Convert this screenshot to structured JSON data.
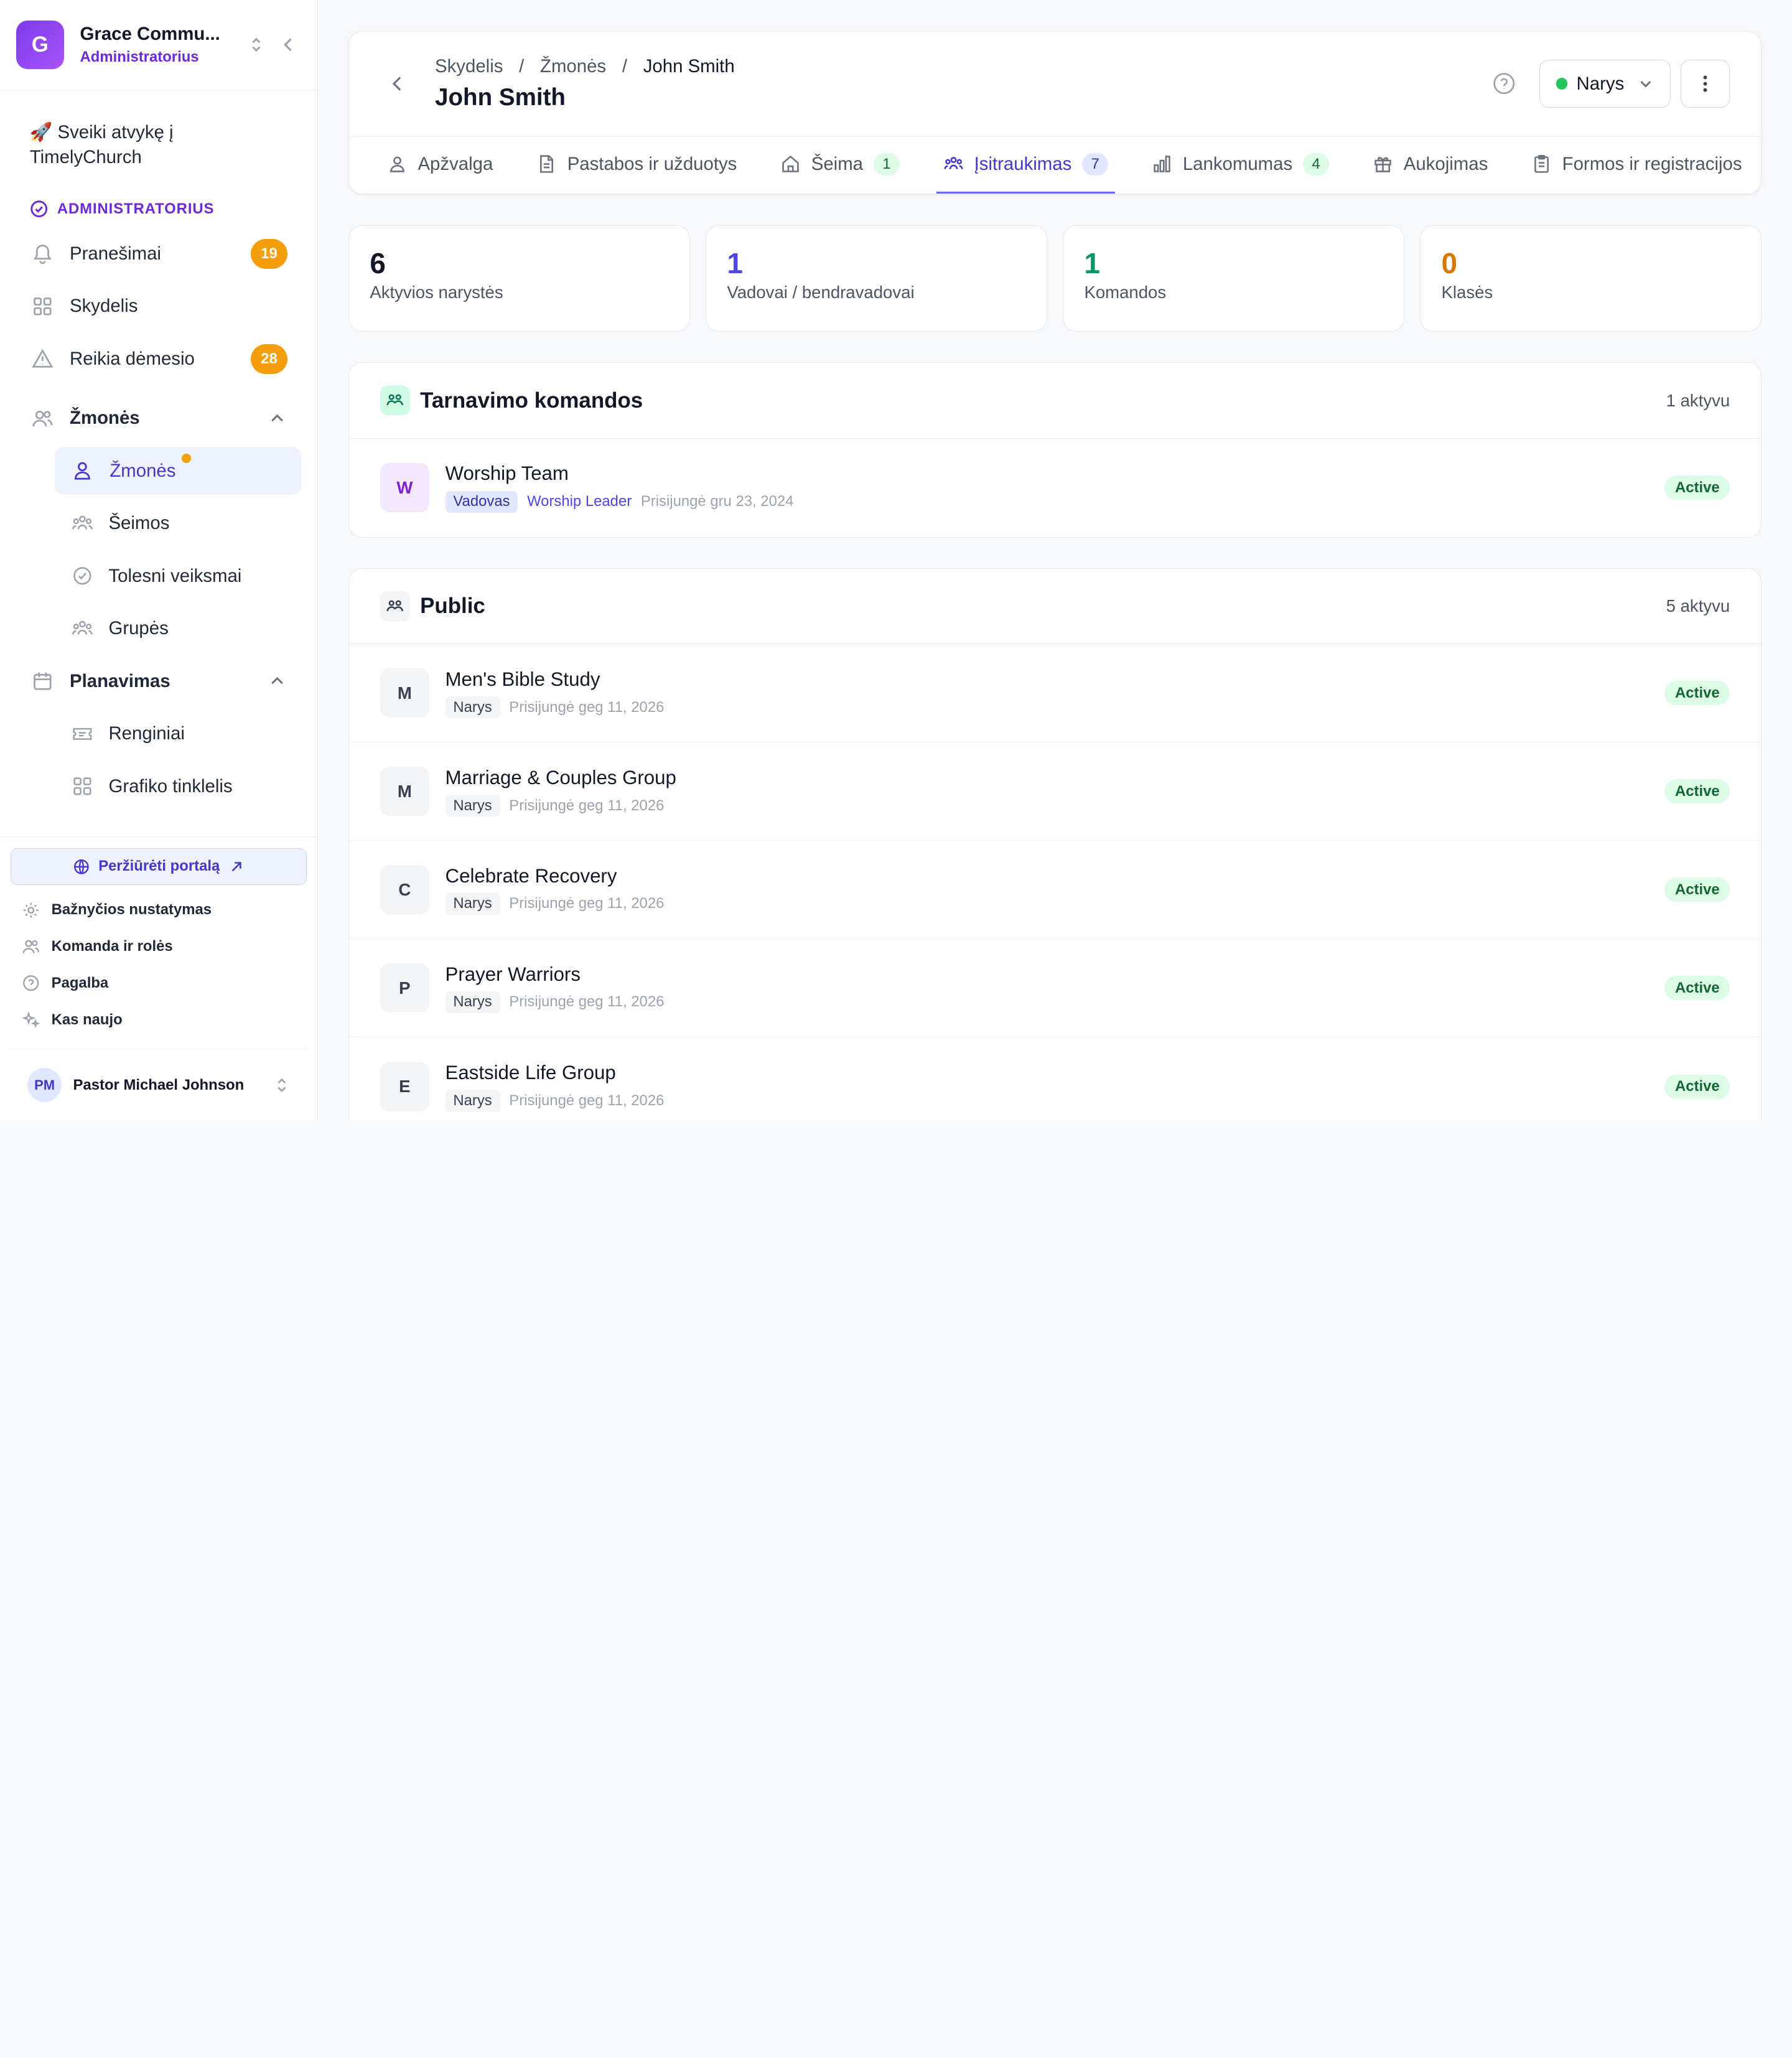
{
  "org": {
    "logo_letter": "G",
    "name": "Grace Commu...",
    "role": "Administratorius"
  },
  "welcome": "🚀 Sveiki atvykę į TimelyChurch",
  "nav": {
    "section_label": "ADMINISTRATORIUS",
    "notifications": {
      "label": "Pranešimai",
      "badge": "19"
    },
    "dashboard": {
      "label": "Skydelis"
    },
    "attention": {
      "label": "Reikia dėmesio",
      "badge": "28"
    },
    "people_group": {
      "label": "Žmonės"
    },
    "people_items": [
      {
        "label": "Žmonės"
      },
      {
        "label": "Šeimos"
      },
      {
        "label": "Tolesni veiksmai"
      },
      {
        "label": "Grupės"
      }
    ],
    "planning_group": {
      "label": "Planavimas"
    },
    "planning_items": [
      {
        "label": "Renginiai"
      },
      {
        "label": "Grafiko tinklelis"
      }
    ]
  },
  "sidebar_bottom": {
    "portal": "Peržiūrėti portalą",
    "items": [
      "Bažnyčios nustatymas",
      "Komanda ir rolės",
      "Pagalba",
      "Kas naujo"
    ],
    "user": {
      "initials": "PM",
      "name": "Pastor Michael Johnson"
    }
  },
  "header": {
    "breadcrumbs": [
      "Skydelis",
      "Žmonės",
      "John Smith"
    ],
    "separator": "/",
    "title": "John Smith",
    "status": "Narys"
  },
  "tabs": [
    {
      "label": "Apžvalga"
    },
    {
      "label": "Pastabos ir užduotys"
    },
    {
      "label": "Šeima",
      "count": "1"
    },
    {
      "label": "Įsitraukimas",
      "count": "7"
    },
    {
      "label": "Lankomumas",
      "count": "4"
    },
    {
      "label": "Aukojimas"
    },
    {
      "label": "Formos ir registracijos"
    }
  ],
  "stats": [
    {
      "value": "6",
      "label": "Aktyvios narystės",
      "color": "#111827"
    },
    {
      "value": "1",
      "label": "Vadovai / bendravadovai",
      "color": "#4f46e5"
    },
    {
      "value": "1",
      "label": "Komandos",
      "color": "#059669"
    },
    {
      "value": "0",
      "label": "Klasės",
      "color": "#d97706"
    }
  ],
  "teams": {
    "title": "Tarnavimo komandos",
    "count": "1 aktyvu",
    "rows": [
      {
        "initial": "W",
        "name": "Worship Team",
        "role_chip": "Vadovas",
        "role": "Worship Leader",
        "joined": "Prisijungė gru 23, 2024",
        "status": "Active"
      }
    ]
  },
  "public": {
    "title": "Public",
    "count": "5 aktyvu",
    "rows": [
      {
        "initial": "M",
        "name": "Men's Bible Study",
        "role_chip": "Narys",
        "joined": "Prisijungė geg 11, 2026",
        "status": "Active"
      },
      {
        "initial": "M",
        "name": "Marriage & Couples Group",
        "role_chip": "Narys",
        "joined": "Prisijungė geg 11, 2026",
        "status": "Active"
      },
      {
        "initial": "C",
        "name": "Celebrate Recovery",
        "role_chip": "Narys",
        "joined": "Prisijungė geg 11, 2026",
        "status": "Active"
      },
      {
        "initial": "P",
        "name": "Prayer Warriors",
        "role_chip": "Narys",
        "joined": "Prisijungė geg 11, 2026",
        "status": "Active"
      },
      {
        "initial": "E",
        "name": "Eastside Life Group",
        "role_chip": "Narys",
        "joined": "Prisijungė geg 11, 2026",
        "status": "Active"
      }
    ]
  }
}
